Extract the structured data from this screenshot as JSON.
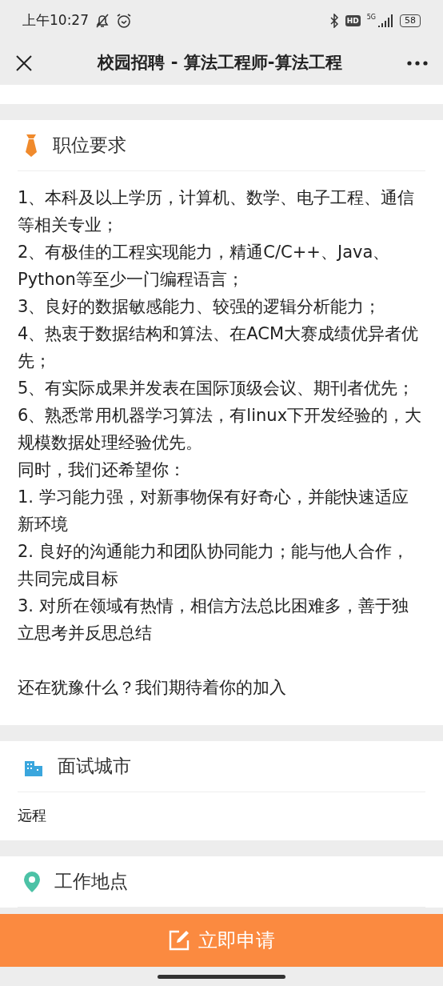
{
  "status_bar": {
    "time": "上午10:27",
    "hd": "HD",
    "battery": "58",
    "network": "5G"
  },
  "nav": {
    "title": "校园招聘 - 算法工程师-算法工程"
  },
  "sections": [
    {
      "kind": "requirements",
      "title": "职位要求",
      "paragraphs": [
        "1、本科及以上学历，计算机、数学、电子工程、通信等相关专业；",
        "2、有极佳的工程实现能力，精通C/C++、Java、Python等至少一门编程语言；",
        "3、良好的数据敏感能力、较强的逻辑分析能力；",
        "4、热衷于数据结构和算法、在ACM大赛成绩优异者优先；",
        "5、有实际成果并发表在国际顶级会议、期刊者优先；",
        "6、熟悉常用机器学习算法，有linux下开发经验的，大规模数据处理经验优先。",
        "同时，我们还希望你：",
        "1. 学习能力强，对新事物保有好奇心，并能快速适应新环境",
        "2. 良好的沟通能力和团队协同能力；能与他人合作，共同完成目标",
        "3. 对所在领域有热情，相信方法总比困难多，善于独立思考并反思总结"
      ],
      "closing": "还在犹豫什么？我们期待着你的加入"
    },
    {
      "kind": "city",
      "title": "面试城市",
      "paragraphs": [
        "远程"
      ]
    },
    {
      "kind": "location",
      "title": "工作地点"
    }
  ],
  "apply_button": {
    "label": "立即申请"
  }
}
